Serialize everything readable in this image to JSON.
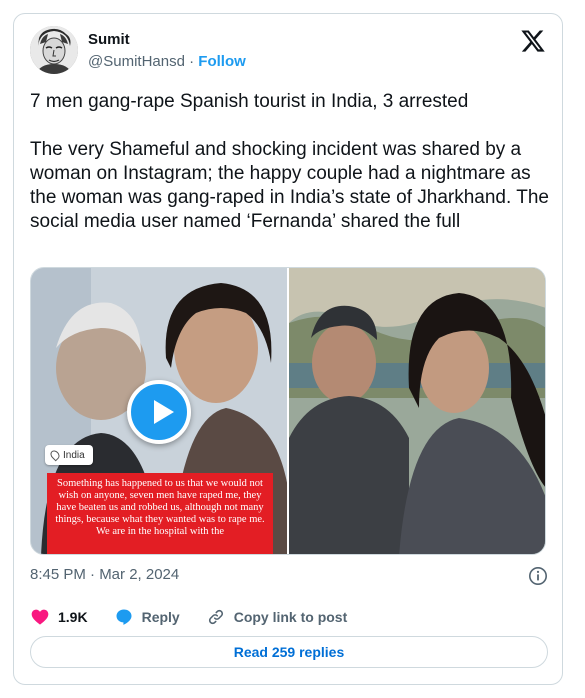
{
  "colors": {
    "accent": "#1d9bf0",
    "text": "#0f1419",
    "muted": "#536471",
    "border": "#cfd9de",
    "like": "#f91880",
    "caption_bg": "#e31e24",
    "link": "#006fd6"
  },
  "author": {
    "name": "Sumit",
    "handle": "@SumitHansd",
    "separator": "·",
    "follow_label": "Follow",
    "avatar_icon": "avatar-sketch"
  },
  "platform_icon": "x-logo-icon",
  "tweet": {
    "text": "7 men gang-rape Spanish tourist in India, 3 arrested\n\nThe very Shameful and shocking incident was shared by a woman on Instagram; the happy couple had a nightmare as the woman was gang-raped in India’s state of Jharkhand. The social media user named ‘Fernanda’ shared the full"
  },
  "media": {
    "location_badge": "India",
    "video_caption": "Something has happened to us that we would not wish on anyone, seven men have raped me, they have beaten us and robbed us, although not many things, because what they wanted was to rape me. We are in the hospital with the",
    "play_icon": "play-icon"
  },
  "meta": {
    "timestamp": "8:45 PM · Mar 2, 2024",
    "info_icon": "info-icon"
  },
  "actions": {
    "like_count": "1.9K",
    "reply_label": "Reply",
    "copy_link_label": "Copy link to post"
  },
  "footer": {
    "read_replies_label": "Read 259 replies"
  }
}
